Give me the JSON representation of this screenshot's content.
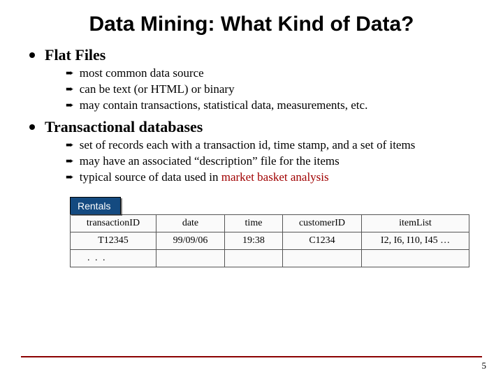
{
  "title": "Data Mining: What Kind of Data?",
  "sections": [
    {
      "heading": "Flat Files",
      "points": [
        "most common data source",
        "can be text (or HTML) or binary",
        "may contain transactions, statistical data, measurements, etc."
      ]
    },
    {
      "heading": "Transactional databases",
      "points": [
        "set of records each with a transaction id, time stamp, and a set of items",
        "may have an associated “description” file for the items",
        "typical source of data used in "
      ],
      "last_point_highlight": "market basket analysis"
    }
  ],
  "table": {
    "name": "Rentals",
    "headers": [
      "transactionID",
      "date",
      "time",
      "customerID",
      "itemList"
    ],
    "rows": [
      [
        "T12345",
        "99/09/06",
        "19:38",
        "C1234",
        "I2, I6, I10, I45 …"
      ],
      [
        ". . .",
        "",
        "",
        "",
        ""
      ]
    ]
  },
  "page_number": "5"
}
